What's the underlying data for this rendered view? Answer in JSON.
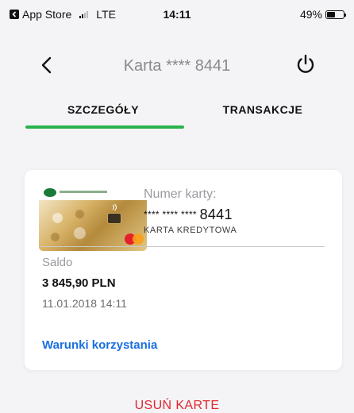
{
  "status_bar": {
    "back_app": "App Store",
    "network": "LTE",
    "time": "14:11",
    "battery_percent": "49%",
    "battery_level": 0.49
  },
  "nav": {
    "title": "Karta **** 8441",
    "back_icon": "chevron-left-icon",
    "power_icon": "power-icon"
  },
  "tabs": [
    {
      "label": "SZCZEGÓŁY",
      "active": true
    },
    {
      "label": "TRANSAKCJE",
      "active": false
    }
  ],
  "colors": {
    "accent_green": "#2bb24c",
    "link_blue": "#1a6fe0",
    "danger_red": "#e0262e"
  },
  "card": {
    "number_label": "Numer karty:",
    "number_masked": "**** **** ****",
    "number_last": "8441",
    "type": "KARTA KREDYTOWA",
    "balance_label": "Saldo",
    "balance_value": "3 845,90 PLN",
    "balance_date": "11.01.2018 14:11",
    "terms_link": "Warunki korzystania"
  },
  "actions": {
    "remove_card": "USUŃ KARTE"
  }
}
